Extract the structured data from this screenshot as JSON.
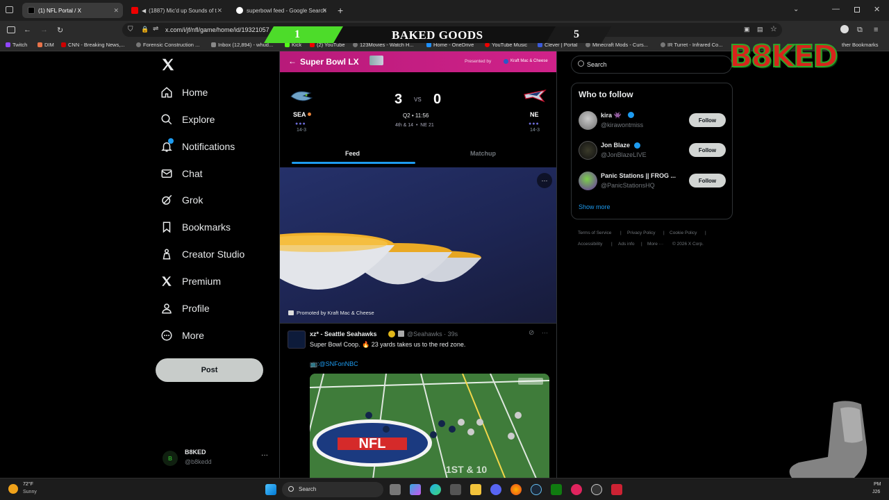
{
  "browser": {
    "tabs": [
      {
        "title": "(1) NFL Portal / X",
        "active": true
      },
      {
        "title": "(1887) Mic'd up Sounds of t",
        "active": false
      },
      {
        "title": "superbowl feed - Google Search",
        "active": false
      }
    ],
    "url": "x.com/i/jf/nfl/game/home/id/19321057",
    "bookmarks": [
      "Twitch",
      "DIM",
      "CNN - Breaking News,...",
      "Forensic Construction ...",
      "Inbox (12,894) - whud...",
      "Kick",
      "(2) YouTube",
      "123Movies - Watch H...",
      "Home - OneDrive",
      "YouTube Music",
      "Clever | Portal",
      "Minecraft Mods - Curs...",
      "IR Turret - Infrared Co...",
      "ther Bookmarks"
    ]
  },
  "overlay": {
    "left_score": "1",
    "title": "BAKED GOODS",
    "right_score": "5",
    "logo": "B8KED"
  },
  "sidebar": {
    "items": [
      {
        "label": "Home",
        "icon": "home-icon"
      },
      {
        "label": "Explore",
        "icon": "search-icon"
      },
      {
        "label": "Notifications",
        "icon": "bell-icon"
      },
      {
        "label": "Chat",
        "icon": "mail-icon"
      },
      {
        "label": "Grok",
        "icon": "grok-icon"
      },
      {
        "label": "Bookmarks",
        "icon": "bookmark-icon"
      },
      {
        "label": "Creator Studio",
        "icon": "creator-icon"
      },
      {
        "label": "Premium",
        "icon": "x-icon"
      },
      {
        "label": "Profile",
        "icon": "person-icon"
      },
      {
        "label": "More",
        "icon": "more-circle-icon"
      }
    ],
    "post_label": "Post",
    "account": {
      "name": "B8KED",
      "handle": "@b8kedd",
      "more": "···"
    }
  },
  "game": {
    "header_title": "Super Bowl LX",
    "presented_by": "Presented by",
    "sponsor": "Kraft Mac & Cheese",
    "home": {
      "abbr": "SEA",
      "record": "14-3"
    },
    "away": {
      "abbr": "NE",
      "record": "14-3"
    },
    "home_score": "3",
    "vs": "VS",
    "away_score": "0",
    "clock": "Q2 • 11:56",
    "situation": "4th & 14  •  NE 21",
    "tabs": [
      "Feed",
      "Matchup"
    ]
  },
  "promo": {
    "label": "Promoted by Kraft Mac & Cheese",
    "more": "···"
  },
  "tweet": {
    "author": "xz* - Seattle Seahawks",
    "handle_time": "@Seahawks · 39s",
    "text": "Super Bowl Coop. 🔥 23 yards takes us to the red zone.",
    "link": ":@SNFonNBC",
    "more": "···",
    "video_overlay": "1ST & 10"
  },
  "right": {
    "search_placeholder": "Search",
    "wtf_title": "Who to follow",
    "follow_label": "Follow",
    "suggestions": [
      {
        "name": "kira 👾",
        "handle": "@kirawontmiss"
      },
      {
        "name": "Jon Blaze",
        "handle": "@JonBlazeLIVE"
      },
      {
        "name": "Panic Stations || FROG ...",
        "handle": "@PanicStationsHQ"
      }
    ],
    "show_more": "Show more",
    "footer": [
      "Terms of Service",
      "Privacy Policy",
      "Cookie Policy",
      "Accessibility",
      "Ads info",
      "More ···",
      "© 2026 X Corp."
    ]
  },
  "taskbar": {
    "weather_temp": "72°F",
    "weather_desc": "Sunny",
    "search_label": "Search",
    "clock_1": "PM",
    "clock_2": "J26"
  },
  "colors": {
    "accent": "#1d9bf0",
    "game_header": "#c81e80",
    "follow_bg": "#d2d5d3"
  }
}
